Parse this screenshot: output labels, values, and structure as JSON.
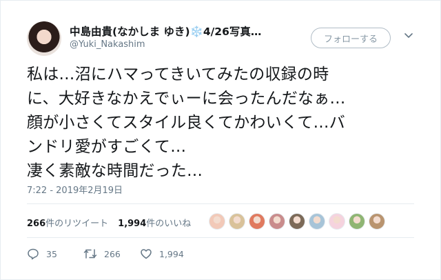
{
  "user": {
    "display_name": "中島由貴(なかしま ゆき)❄️4/26写真…",
    "handle": "@Yuki_Nakashim"
  },
  "follow_button_label": "フォローする",
  "tweet": {
    "text": "私は…沼にハマってきいてみたの収録の時\nに、大好きなかえでぃーに会ったんだなぁ…\n顔が小さくてスタイル良くてかわいくて…バ\nンドリ愛がすごくて…\n凄く素敵な時間だった…",
    "timestamp": "7:22 - 2019年2月19日"
  },
  "stats": {
    "retweets": "266",
    "retweets_label": "件のリツイート",
    "likes": "1,994",
    "likes_label": "件のいいね"
  },
  "likers_avatar_colors": [
    "#f2c9b8",
    "#d9c29a",
    "#e07a5f",
    "#c98c8c",
    "#7c6a58",
    "#a7c4d8",
    "#f5d3de",
    "#8fb573",
    "#b9946f"
  ],
  "actions": {
    "replies": "35",
    "retweets": "266",
    "likes": "1,994"
  },
  "colors": {
    "text": "#14171a",
    "secondary": "#657786",
    "border": "#e6ecf0"
  }
}
